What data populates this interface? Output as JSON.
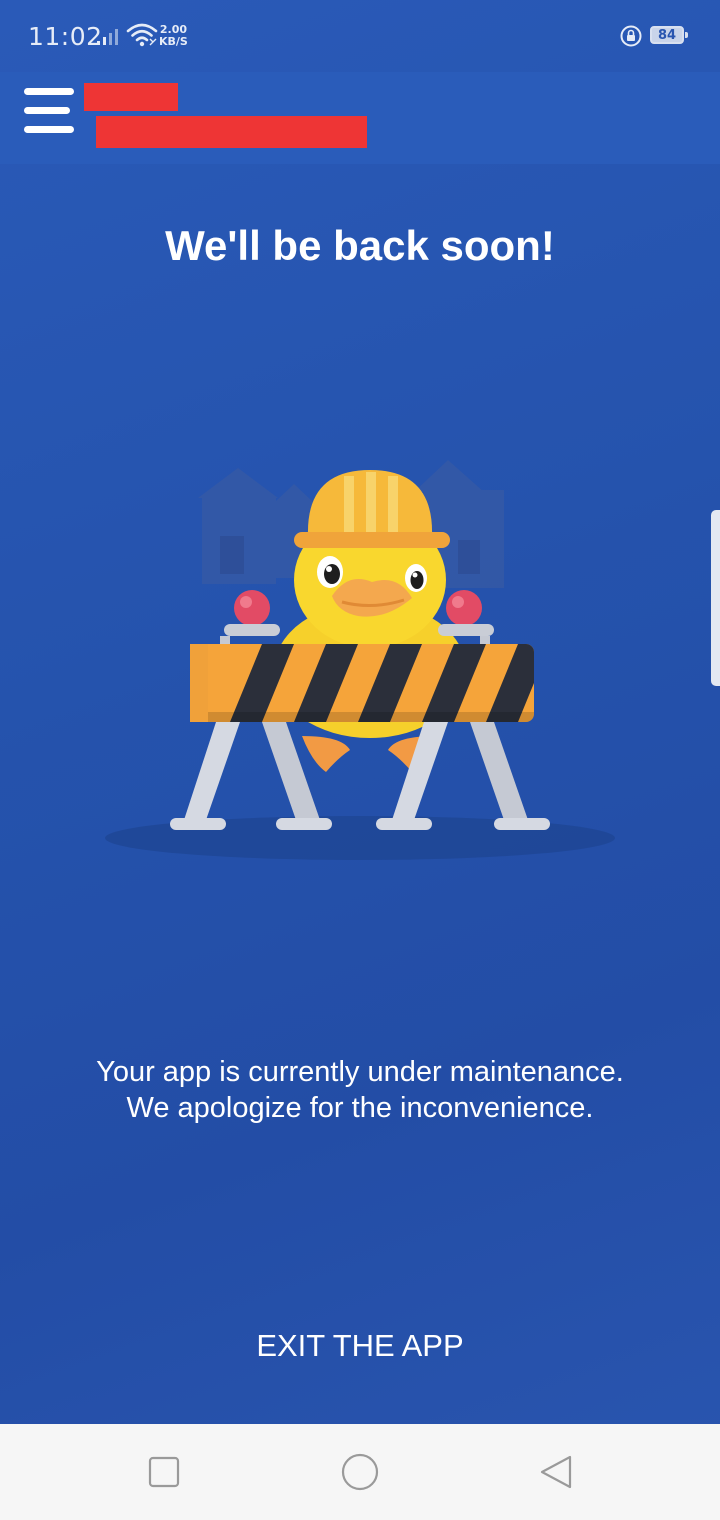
{
  "status_bar": {
    "time": "11:02",
    "net_speed_value": "2.00",
    "net_speed_unit": "KB/S",
    "battery_level": "84",
    "icons": [
      "signal-icon",
      "wifi-icon",
      "lock-icon",
      "battery-icon"
    ]
  },
  "app_bar": {
    "menu_icon": "hamburger-menu-icon",
    "title_redacted": true
  },
  "main": {
    "headline": "We'll be back soon!",
    "illustration": "duck-construction-barrier-illustration",
    "message_line_1": "Your app is currently under maintenance.",
    "message_line_2": "We apologize for the inconvenience.",
    "exit_label": "EXIT THE APP"
  },
  "nav_bar": {
    "buttons": [
      "recents-square-icon",
      "home-circle-icon",
      "back-triangle-icon"
    ]
  },
  "colors": {
    "background": "#2553ad",
    "app_bar": "#2a5cba",
    "redaction": "#ee3535",
    "text": "#ffffff",
    "nav_bar": "#f6f6f6"
  }
}
